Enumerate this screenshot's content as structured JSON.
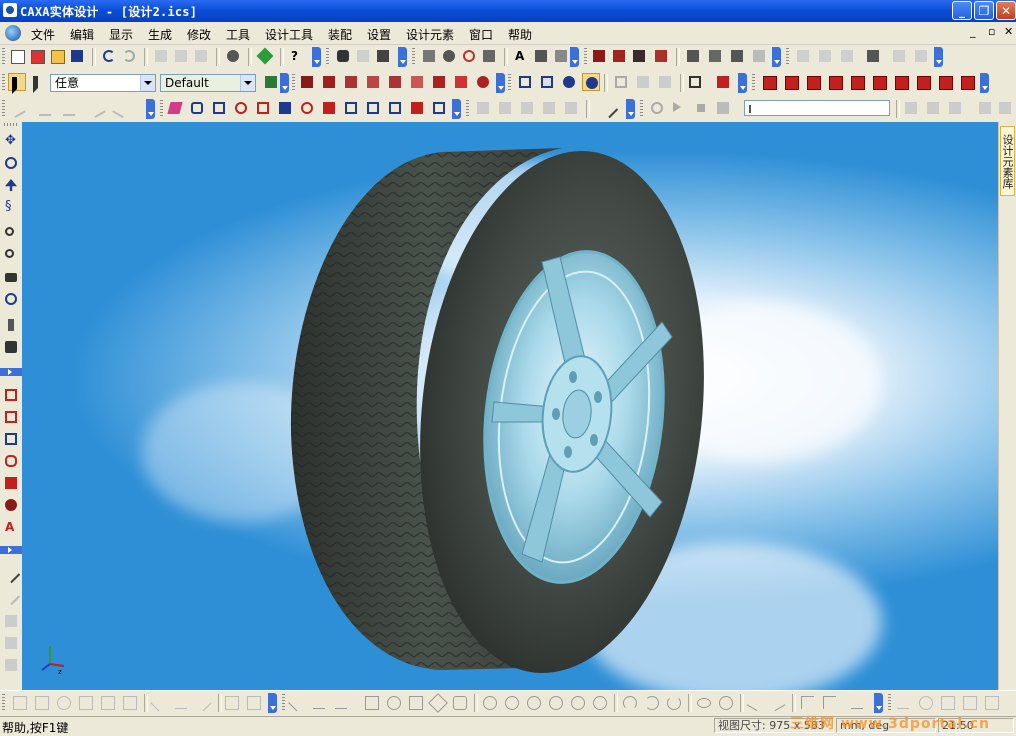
{
  "window": {
    "title": "CAXA实体设计 - [设计2.ics]"
  },
  "menu": {
    "items": [
      "文件",
      "编辑",
      "显示",
      "生成",
      "修改",
      "工具",
      "设计工具",
      "装配",
      "设置",
      "设计元素",
      "窗口",
      "帮助"
    ],
    "mdi_restore": "▫ ▣",
    "mdi_close": "✕"
  },
  "toolbar": {
    "select_filter": "任意",
    "style_combo": "Default"
  },
  "right_panel": {
    "tab_label": "设计元素库"
  },
  "status": {
    "help": "帮助,按F1键",
    "viewsize_label": "视图尺寸: 975 x 583",
    "units": "mm, deg",
    "time": "21:50"
  },
  "watermark": "三维网 www.3dportal.cn",
  "colors": {
    "titlebar": "#0a4fd8",
    "tire": "#3f4640",
    "rim": "#a9d9ea",
    "sky": "#2e8fd6"
  }
}
